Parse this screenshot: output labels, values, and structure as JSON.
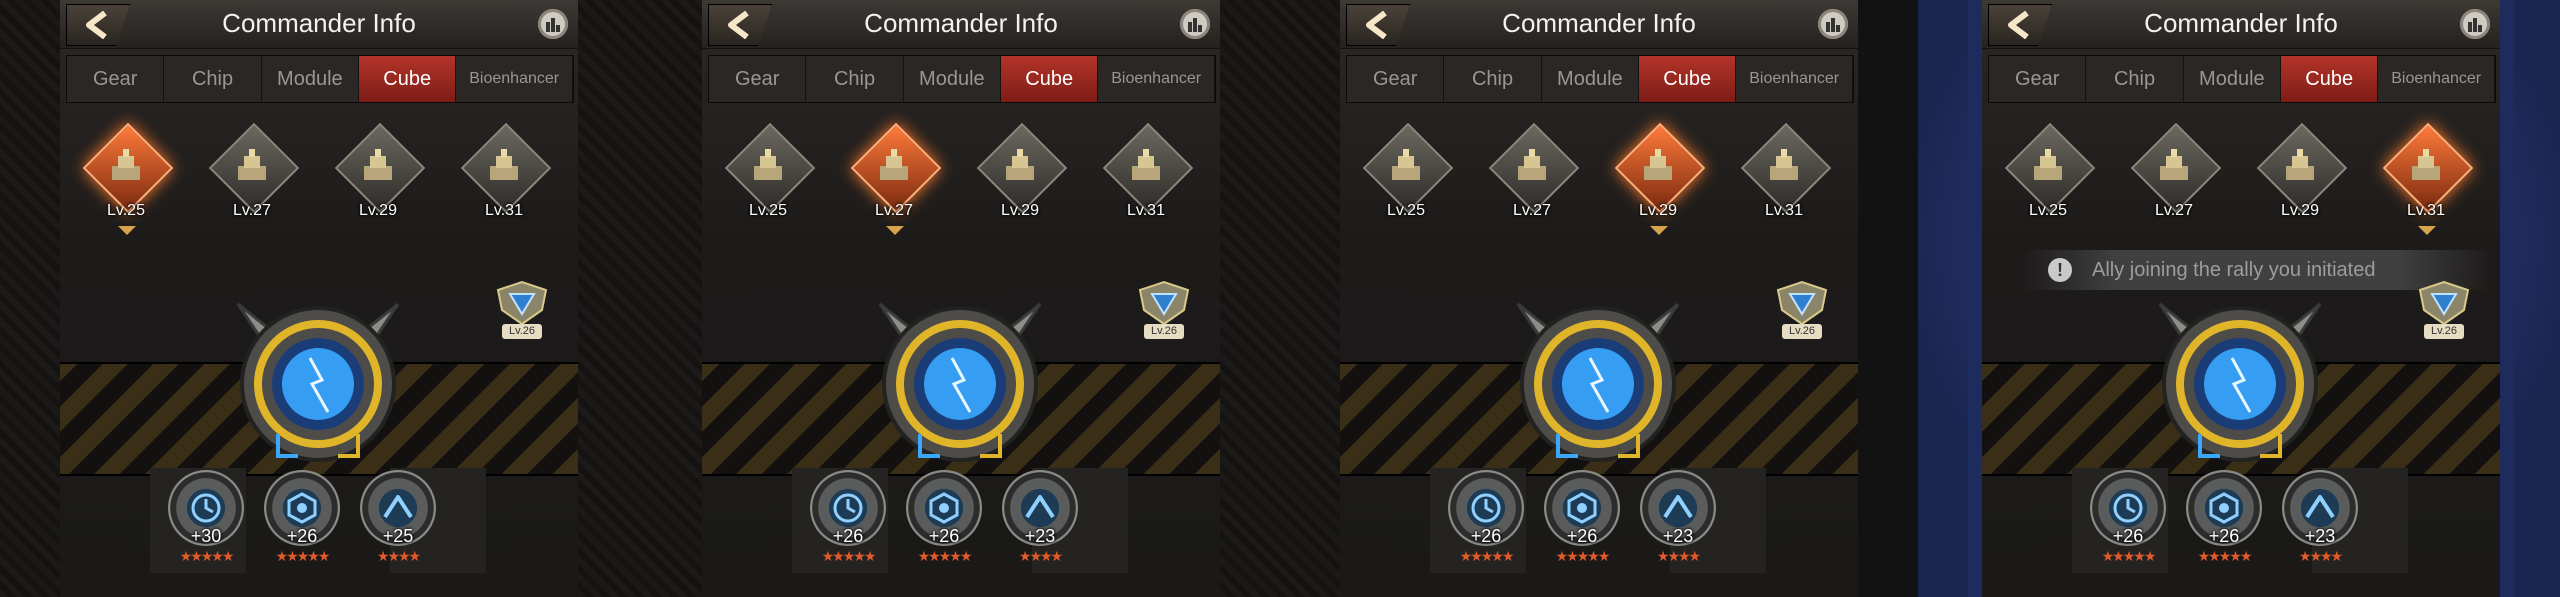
{
  "screens": [
    {
      "title": "Commander Info",
      "tabs": [
        "Gear",
        "Chip",
        "Module",
        "Cube",
        "Bioenhancer"
      ],
      "active_tab": "Cube",
      "cubes": [
        "Lv.25",
        "Lv.27",
        "Lv.29",
        "Lv.31"
      ],
      "selected_cube": 0,
      "core_level": "Lv.26",
      "notice": "",
      "gems": [
        {
          "value": "+30",
          "stars": "★★★★★"
        },
        {
          "value": "+26",
          "stars": "★★★★★"
        },
        {
          "value": "+25",
          "stars": "★★★★"
        }
      ]
    },
    {
      "title": "Commander Info",
      "tabs": [
        "Gear",
        "Chip",
        "Module",
        "Cube",
        "Bioenhancer"
      ],
      "active_tab": "Cube",
      "cubes": [
        "Lv.25",
        "Lv.27",
        "Lv.29",
        "Lv.31"
      ],
      "selected_cube": 1,
      "core_level": "Lv.26",
      "notice": "",
      "gems": [
        {
          "value": "+26",
          "stars": "★★★★★"
        },
        {
          "value": "+26",
          "stars": "★★★★★"
        },
        {
          "value": "+23",
          "stars": "★★★★"
        }
      ]
    },
    {
      "title": "Commander Info",
      "tabs": [
        "Gear",
        "Chip",
        "Module",
        "Cube",
        "Bioenhancer"
      ],
      "active_tab": "Cube",
      "cubes": [
        "Lv.25",
        "Lv.27",
        "Lv.29",
        "Lv.31"
      ],
      "selected_cube": 2,
      "core_level": "Lv.26",
      "notice": "",
      "gems": [
        {
          "value": "+26",
          "stars": "★★★★★"
        },
        {
          "value": "+26",
          "stars": "★★★★★"
        },
        {
          "value": "+23",
          "stars": "★★★★"
        }
      ]
    },
    {
      "title": "Commander Info",
      "tabs": [
        "Gear",
        "Chip",
        "Module",
        "Cube",
        "Bioenhancer"
      ],
      "active_tab": "Cube",
      "cubes": [
        "Lv.25",
        "Lv.27",
        "Lv.29",
        "Lv.31"
      ],
      "selected_cube": 3,
      "core_level": "Lv.26",
      "notice": "Ally joining the rally you initiated",
      "gems": [
        {
          "value": "+26",
          "stars": "★★★★★"
        },
        {
          "value": "+26",
          "stars": "★★★★★"
        },
        {
          "value": "+23",
          "stars": "★★★★"
        }
      ]
    }
  ],
  "colors": {
    "active_tab": "#b3342a",
    "hazard": "#3a2e16",
    "core_glow": "#3aa8ff",
    "star": "#e05a2a"
  }
}
